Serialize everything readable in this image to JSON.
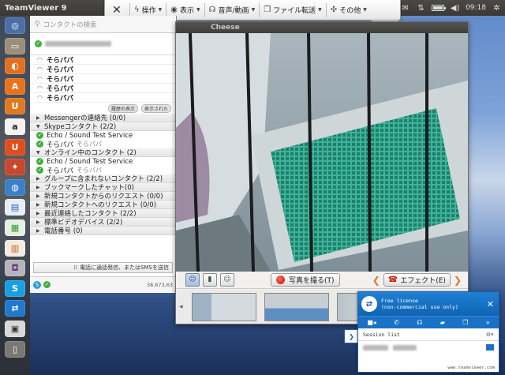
{
  "top_panel": {
    "app_title": "TeamViewer 9",
    "clock": "09:18"
  },
  "tv_toolbar": {
    "items": [
      {
        "label": "操作",
        "icon": "bolt-icon"
      },
      {
        "label": "表示",
        "icon": "eye-icon"
      },
      {
        "label": "音声/動画",
        "icon": "headset-icon"
      },
      {
        "label": "ファイル転送",
        "icon": "file-transfer-icon"
      },
      {
        "label": "その他",
        "icon": "puzzle-icon"
      }
    ]
  },
  "contacts": {
    "search_placeholder": "コンタクトの検索",
    "recent": [
      "そらパパ",
      "そらパパ",
      "そらパパ",
      "そらパパ",
      "そらパパ"
    ],
    "history_buttons": [
      "履歴の表示",
      "表示された"
    ],
    "groups": [
      {
        "label": "Messengerの連絡先 (0/0)",
        "expanded": false,
        "items": []
      },
      {
        "label": "Skypeコンタクト (2/2)",
        "expanded": true,
        "items": [
          {
            "name": "Echo / Sound Test Service",
            "alias": ""
          },
          {
            "name": "そらパパ",
            "alias": "そらパパ"
          }
        ]
      },
      {
        "label": "オンライン中のコンタクト (2)",
        "expanded": true,
        "items": [
          {
            "name": "Echo / Sound Test Service",
            "alias": ""
          },
          {
            "name": "そらパパ",
            "alias": "そらパパ"
          }
        ]
      },
      {
        "label": "グループに含まれないコンタクト (2/2)",
        "expanded": false,
        "items": []
      },
      {
        "label": "ブックマークしたチャット(0)",
        "expanded": false,
        "items": []
      },
      {
        "label": "新規コンタクトからのリクエスト (0/0)",
        "expanded": false,
        "items": []
      },
      {
        "label": "新規コンタクトへのリクエスト (0/0)",
        "expanded": false,
        "items": []
      },
      {
        "label": "最近連絡したコンタクト (2/2)",
        "expanded": false,
        "items": []
      },
      {
        "label": "標準ビデオデバイス (2/2)",
        "expanded": false,
        "items": []
      },
      {
        "label": "電話番号 (0)",
        "expanded": false,
        "items": []
      }
    ],
    "call_bar_label": "電話に通話発信、またはSMSを送信",
    "online_count": "38,673,63"
  },
  "cheese": {
    "title": "Cheese",
    "shoot_label": "写真を撮る(T)",
    "effects_label": "エフェクト(E)"
  },
  "tv_panel": {
    "license_line1": "Free license",
    "license_line2": "(non-commercial use only)",
    "session_list": "Session list",
    "footer": "www.teamviewer.com"
  },
  "colors": {
    "tv_blue": "#1063b4",
    "accent_orange": "#e07a20",
    "online_green": "#3faf3f"
  }
}
